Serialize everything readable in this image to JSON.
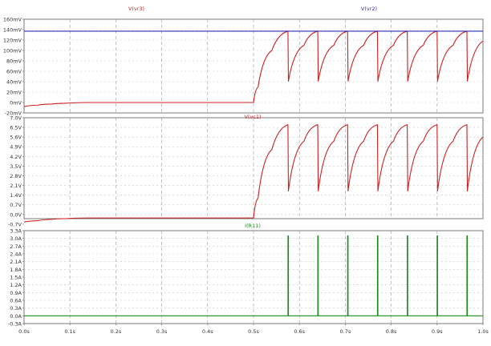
{
  "chart_data": [
    {
      "type": "line",
      "title": "",
      "xlabel": "",
      "ylabel": "",
      "ylim": [
        -20,
        160
      ],
      "ytick_labels": [
        "160mV",
        "140mV",
        "120mV",
        "100mV",
        "80mV",
        "60mV",
        "40mV",
        "20mV",
        "0mV",
        "-20mV"
      ],
      "ytick_values": [
        160,
        140,
        120,
        100,
        80,
        60,
        40,
        20,
        0,
        -20
      ],
      "trace_labels": [
        "V(vr3)",
        "V(vr2)"
      ],
      "series": [
        {
          "name": "V(vr3)",
          "color": "#cc1f1f",
          "x": [
            0.0,
            0.03,
            0.06,
            0.09,
            0.14,
            0.5,
            0.51,
            0.54,
            0.575,
            0.576,
            0.61,
            0.64,
            0.641,
            0.675,
            0.705,
            0.706,
            0.74,
            0.77,
            0.771,
            0.805,
            0.835,
            0.836,
            0.87,
            0.9,
            0.901,
            0.935,
            0.965,
            0.966,
            1.0
          ],
          "values": [
            -8,
            -5,
            -3,
            -1.5,
            0,
            0,
            30,
            100,
            137,
            41,
            110,
            137,
            41,
            110,
            137,
            41,
            110,
            137,
            41,
            110,
            137,
            41,
            110,
            137,
            41,
            110,
            137,
            41,
            118
          ]
        },
        {
          "name": "V(vr2)",
          "color": "#2b2bb5",
          "x": [
            0.0,
            1.0
          ],
          "values": [
            137,
            137
          ]
        }
      ]
    },
    {
      "type": "line",
      "title": "",
      "xlabel": "",
      "ylabel": "",
      "ylim": [
        -0.3,
        7.0
      ],
      "ytick_labels": [
        "7.0V",
        "6.5V",
        "5.6V",
        "4.9V",
        "4.2V",
        "3.5V",
        "2.8V",
        "2.1V",
        "1.4V",
        "0.7V",
        "0.0V",
        "-0.7V"
      ],
      "ytick_values": [
        7.0,
        6.3,
        5.6,
        4.9,
        4.2,
        3.5,
        2.8,
        2.1,
        1.4,
        0.7,
        0.0,
        -0.7
      ],
      "trace_labels": [
        "V(vc1)"
      ],
      "series": [
        {
          "name": "V(vc1)",
          "color": "#cc1f1f",
          "x": [
            0.0,
            0.03,
            0.06,
            0.09,
            0.14,
            0.5,
            0.51,
            0.54,
            0.575,
            0.576,
            0.61,
            0.64,
            0.641,
            0.675,
            0.705,
            0.706,
            0.74,
            0.77,
            0.771,
            0.805,
            0.835,
            0.836,
            0.87,
            0.9,
            0.901,
            0.935,
            0.965,
            0.966,
            1.0
          ],
          "values": [
            -0.55,
            -0.45,
            -0.35,
            -0.3,
            -0.25,
            -0.25,
            1.2,
            4.7,
            6.5,
            1.7,
            5.3,
            6.5,
            1.7,
            5.3,
            6.5,
            1.7,
            5.3,
            6.5,
            1.7,
            5.3,
            6.5,
            1.7,
            5.3,
            6.5,
            1.7,
            5.3,
            6.5,
            1.7,
            5.6
          ]
        }
      ]
    },
    {
      "type": "line",
      "title": "",
      "xlabel": "",
      "ylabel": "",
      "ylim": [
        -0.3,
        3.3
      ],
      "ytick_labels": [
        "3.3A",
        "3.0A",
        "2.7A",
        "2.4A",
        "2.1A",
        "1.8A",
        "1.5A",
        "1.2A",
        "0.9A",
        "0.6A",
        "0.3A",
        "0.0A",
        "-0.3A"
      ],
      "ytick_values": [
        3.3,
        3.0,
        2.7,
        2.4,
        2.1,
        1.8,
        1.5,
        1.2,
        0.9,
        0.6,
        0.3,
        0.0,
        -0.3
      ],
      "x_tick_labels": [
        "0.0s",
        "0.1s",
        "0.2s",
        "0.3s",
        "0.4s",
        "0.5s",
        "0.6s",
        "0.7s",
        "0.8s",
        "0.9s",
        "1.0s"
      ],
      "xlim": [
        0.0,
        1.0
      ],
      "trace_labels": [
        "I(R11)"
      ],
      "series": [
        {
          "name": "I(R11)",
          "color": "#1e8a1e",
          "spike_times": [
            0.575,
            0.64,
            0.705,
            0.77,
            0.835,
            0.9,
            0.965
          ],
          "spike_peak": 3.1,
          "baseline": 0.0
        }
      ]
    }
  ]
}
